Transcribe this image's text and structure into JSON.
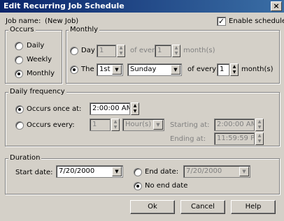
{
  "window": {
    "title": "Edit Recurring Job Schedule",
    "close_glyph": "×"
  },
  "job_name": {
    "label": "Job name:",
    "value": "(New Job)"
  },
  "enable_schedule": {
    "label": "Enable schedule",
    "checked": true,
    "mark": "✓"
  },
  "occurs": {
    "group_label": "Occurs",
    "options": [
      "Daily",
      "Weekly",
      "Monthly"
    ],
    "selected": "Monthly"
  },
  "monthly": {
    "group_label": "Monthly",
    "day_option": {
      "label": "Day",
      "day_value": "1",
      "of_every_label": "of every",
      "months_value": "1",
      "months_label": "month(s)"
    },
    "the_option": {
      "label": "The",
      "ordinal": "1st",
      "weekday": "Sunday",
      "of_every_label": "of every",
      "months_value": "1",
      "months_label": "month(s)"
    },
    "selected": "The"
  },
  "daily_frequency": {
    "group_label": "Daily frequency",
    "once_label": "Occurs once at:",
    "once_time": "2:00:00 AM",
    "every_label": "Occurs every:",
    "every_value": "1",
    "every_unit": "Hour(s)",
    "starting_label": "Starting at:",
    "starting_value": "2:00:00 AM",
    "ending_label": "Ending at:",
    "ending_value": "11:59:59 PM",
    "selected": "once"
  },
  "duration": {
    "group_label": "Duration",
    "start_label": "Start date:",
    "start_value": "7/20/2000",
    "end_date_label": "End date:",
    "end_date_value": "7/20/2000",
    "no_end_label": "No end date",
    "selected": "no_end"
  },
  "buttons": {
    "ok": "Ok",
    "cancel": "Cancel",
    "help": "Help"
  }
}
